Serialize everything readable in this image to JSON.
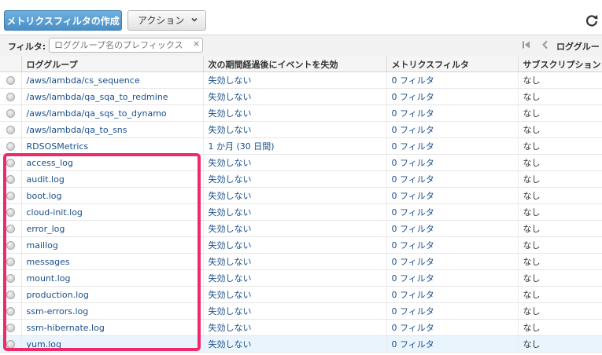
{
  "toolbar": {
    "create_button": "メトリクスフィルタの作成",
    "action_button": "アクション"
  },
  "filter": {
    "label": "フィルタ:",
    "placeholder": "ロググループ名のプレフィックス",
    "clear": "×"
  },
  "pagination": {
    "text": "ロググルー"
  },
  "table": {
    "headers": [
      "ロググループ",
      "次の期間経過後にイベントを失効",
      "メトリクスフィルタ",
      "サブスクリプション"
    ],
    "rows": [
      {
        "group": "/aws/lambda/cs_sequence",
        "expire": "失効しない",
        "filters": "0 フィルタ",
        "subs": "なし"
      },
      {
        "group": "/aws/lambda/qa_sqa_to_redmine",
        "expire": "失効しない",
        "filters": "0 フィルタ",
        "subs": "なし"
      },
      {
        "group": "/aws/lambda/qa_sqs_to_dynamo",
        "expire": "失効しない",
        "filters": "0 フィルタ",
        "subs": "なし"
      },
      {
        "group": "/aws/lambda/qa_to_sns",
        "expire": "失効しない",
        "filters": "0 フィルタ",
        "subs": "なし"
      },
      {
        "group": "RDSOSMetrics",
        "expire": "1 か月 (30 日間)",
        "filters": "0 フィルタ",
        "subs": "なし"
      },
      {
        "group": "access_log",
        "expire": "失効しない",
        "filters": "0 フィルタ",
        "subs": "なし"
      },
      {
        "group": "audit.log",
        "expire": "失効しない",
        "filters": "0 フィルタ",
        "subs": "なし"
      },
      {
        "group": "boot.log",
        "expire": "失効しない",
        "filters": "0 フィルタ",
        "subs": "なし"
      },
      {
        "group": "cloud-init.log",
        "expire": "失効しない",
        "filters": "0 フィルタ",
        "subs": "なし"
      },
      {
        "group": "error_log",
        "expire": "失効しない",
        "filters": "0 フィルタ",
        "subs": "なし"
      },
      {
        "group": "maillog",
        "expire": "失効しない",
        "filters": "0 フィルタ",
        "subs": "なし"
      },
      {
        "group": "messages",
        "expire": "失効しない",
        "filters": "0 フィルタ",
        "subs": "なし"
      },
      {
        "group": "mount.log",
        "expire": "失効しない",
        "filters": "0 フィルタ",
        "subs": "なし"
      },
      {
        "group": "production.log",
        "expire": "失効しない",
        "filters": "0 フィルタ",
        "subs": "なし"
      },
      {
        "group": "ssm-errors.log",
        "expire": "失効しない",
        "filters": "0 フィルタ",
        "subs": "なし"
      },
      {
        "group": "ssm-hibernate.log",
        "expire": "失効しない",
        "filters": "0 フィルタ",
        "subs": "なし"
      },
      {
        "group": "yum.log",
        "expire": "失効しない",
        "filters": "0 フィルタ",
        "subs": "なし"
      }
    ]
  },
  "icons": {
    "refresh": "refresh-icon",
    "dropdown": "chevron-down-icon",
    "first_page": "first-page-icon",
    "prev_page": "chevron-left-icon",
    "row_select": "radio-icon"
  },
  "colors": {
    "primary_button": "#4a8fc6",
    "link": "#1a4f8c",
    "highlight_border": "#ee2a6a",
    "selected_row": "#eaf4fc"
  }
}
